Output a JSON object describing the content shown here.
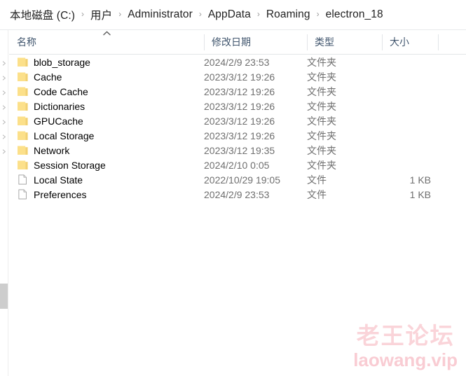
{
  "address_bar": {
    "separator": "›",
    "crumbs": [
      {
        "label": "本地磁盘 (C:)"
      },
      {
        "label": "用户"
      },
      {
        "label": "Administrator"
      },
      {
        "label": "AppData"
      },
      {
        "label": "Roaming"
      },
      {
        "label": "electron_18"
      }
    ]
  },
  "columns": [
    {
      "label": "名称",
      "key": "name"
    },
    {
      "label": "修改日期",
      "key": "date"
    },
    {
      "label": "类型",
      "key": "type"
    },
    {
      "label": "大小",
      "key": "size"
    }
  ],
  "sort": {
    "column": "名称",
    "direction": "ascending",
    "indicator_icon": "chevron-up-icon",
    "indicator_glyph": "︿"
  },
  "rows": [
    {
      "name": "blob_storage",
      "date": "2024/2/9 23:53",
      "type": "文件夹",
      "size": "",
      "icon": "folder-icon"
    },
    {
      "name": "Cache",
      "date": "2023/3/12 19:26",
      "type": "文件夹",
      "size": "",
      "icon": "folder-icon"
    },
    {
      "name": "Code Cache",
      "date": "2023/3/12 19:26",
      "type": "文件夹",
      "size": "",
      "icon": "folder-icon"
    },
    {
      "name": "Dictionaries",
      "date": "2023/3/12 19:26",
      "type": "文件夹",
      "size": "",
      "icon": "folder-icon"
    },
    {
      "name": "GPUCache",
      "date": "2023/3/12 19:26",
      "type": "文件夹",
      "size": "",
      "icon": "folder-icon"
    },
    {
      "name": "Local Storage",
      "date": "2023/3/12 19:26",
      "type": "文件夹",
      "size": "",
      "icon": "folder-icon"
    },
    {
      "name": "Network",
      "date": "2023/3/12 19:35",
      "type": "文件夹",
      "size": "",
      "icon": "folder-icon"
    },
    {
      "name": "Session Storage",
      "date": "2024/2/10 0:05",
      "type": "文件夹",
      "size": "",
      "icon": "folder-icon"
    },
    {
      "name": "Local State",
      "date": "2022/10/29 19:05",
      "type": "文件",
      "size": "1 KB",
      "icon": "file-icon"
    },
    {
      "name": "Preferences",
      "date": "2024/2/9 23:53",
      "type": "文件",
      "size": "1 KB",
      "icon": "file-icon"
    }
  ],
  "watermark": {
    "line1": "老王论坛",
    "line2": "laowang.vip",
    "color": "#fad4d9"
  },
  "colors": {
    "folder": "#fce08a",
    "folder_tab": "#f2d172",
    "header_text": "#41566e",
    "row_text": "#000000",
    "meta_text": "#6f6f6f",
    "scrollbar_thumb": "#cdcdcd"
  }
}
